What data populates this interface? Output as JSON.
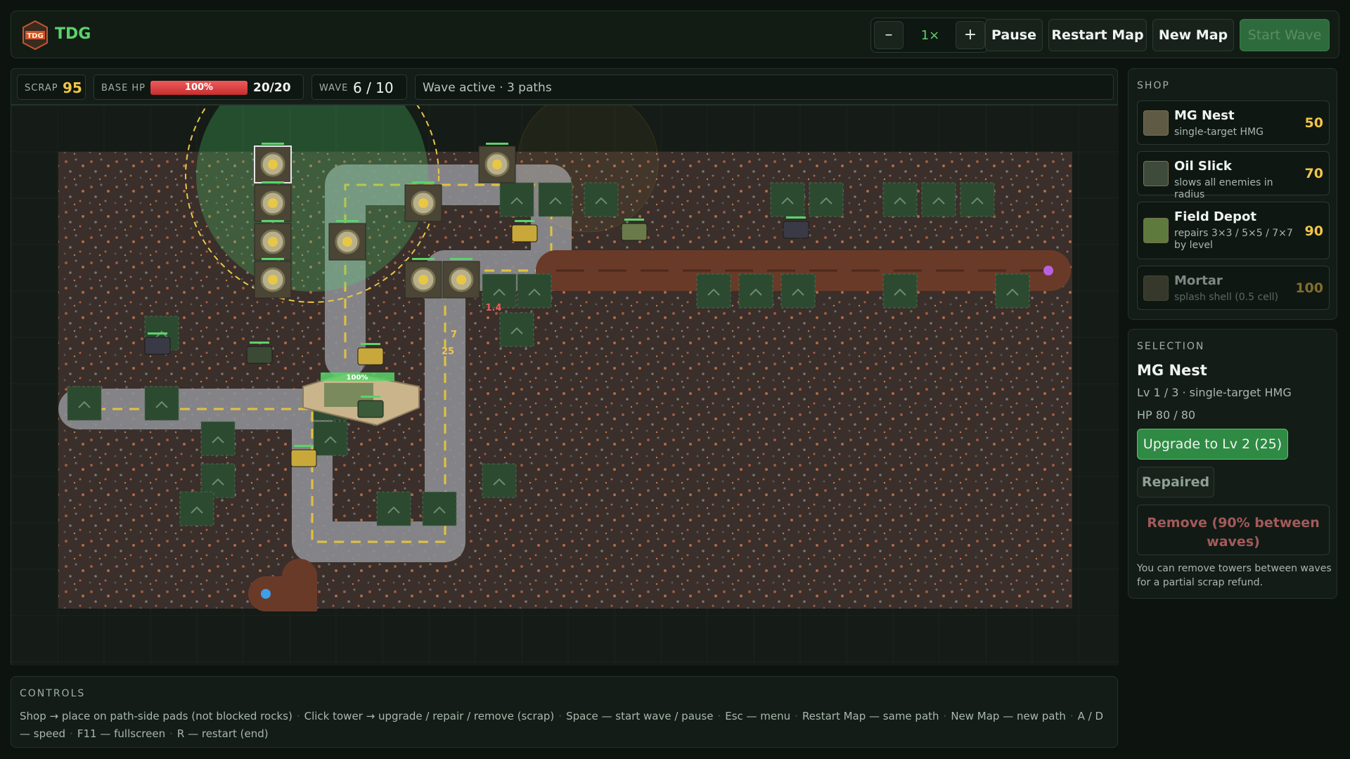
{
  "app": {
    "brand": "TDG",
    "logo_icon": "tdg-emblem-icon"
  },
  "toolbar": {
    "speed_minus": "–",
    "speed_value": "1×",
    "speed_plus": "+",
    "pause": "Pause",
    "restart_map": "Restart Map",
    "new_map": "New Map",
    "start_wave": "Start Wave"
  },
  "hud": {
    "scrap_label": "SCRAP",
    "scrap_value": "95",
    "base_hp_label": "BASE HP",
    "base_hp_percent": "100%",
    "base_hp_fraction": 1.0,
    "base_hp_value": "20/20",
    "wave_label": "WAVE",
    "wave_value": "6 / 10",
    "status": "Wave active · 3 paths"
  },
  "board": {
    "base_hp_label": "100%",
    "range_readout": "1.4",
    "enemy_counter_a": "7",
    "enemy_counter_b": "25",
    "colors": {
      "ground": "#3b2f29",
      "road": "#8d8e92",
      "dirt_road": "#6a3a28",
      "pad": "#2c4a30",
      "range": "#4fd36e"
    }
  },
  "shop": {
    "title": "SHOP",
    "items": [
      {
        "name": "MG Nest",
        "desc": "single-target HMG",
        "cost": "50",
        "icon": "mg-nest-icon"
      },
      {
        "name": "Oil Slick",
        "desc": "slows all enemies in radius",
        "cost": "70",
        "icon": "oil-slick-icon"
      },
      {
        "name": "Field Depot",
        "desc": "repairs 3×3 / 5×5 / 7×7 by level",
        "cost": "90",
        "icon": "field-depot-icon"
      },
      {
        "name": "Mortar",
        "desc": "splash shell (0.5 cell)",
        "cost": "100",
        "icon": "mortar-icon"
      }
    ]
  },
  "selection": {
    "title": "SELECTION",
    "name": "MG Nest",
    "level_line": "Lv 1 / 3 · single-target HMG",
    "hp_line": "HP 80 / 80",
    "upgrade": "Upgrade to Lv 2 (25)",
    "repaired": "Repaired",
    "remove": "Remove (90% between waves)",
    "hint": "You can remove towers between waves for a partial scrap refund."
  },
  "controls": {
    "title": "CONTROLS",
    "items": [
      "Shop → place on path-side pads (not blocked rocks)",
      "Click tower → upgrade / repair / remove (scrap)",
      "Space — start wave / pause",
      "Esc — menu",
      "Restart Map — same path",
      "New Map — new path",
      "A / D — speed",
      "F11 — fullscreen",
      "R — restart (end)"
    ]
  }
}
